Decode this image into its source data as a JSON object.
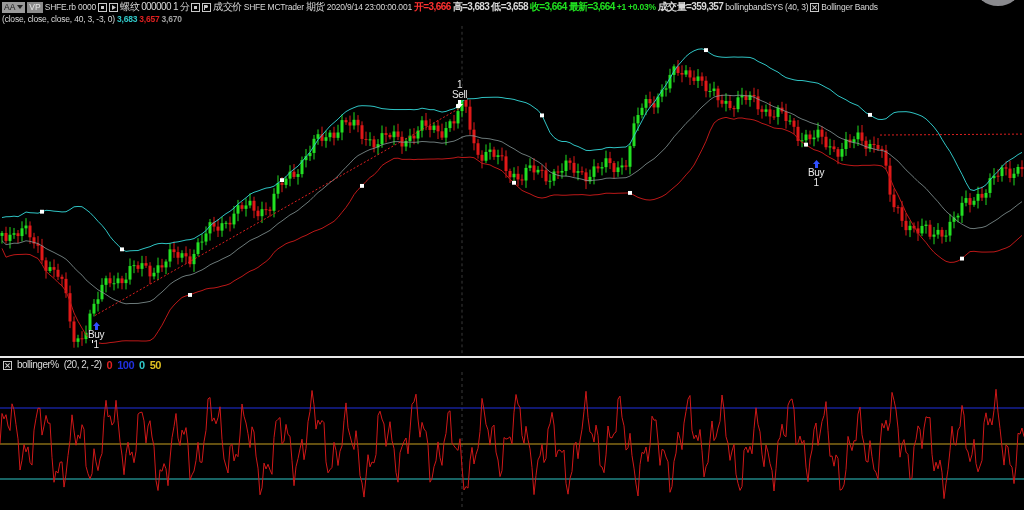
{
  "toolbar": {
    "font_button": "AA",
    "volume_profile_button": "VP",
    "symbol": "SHFE.rb 0000",
    "instrument": "螺纹 000000",
    "interval": "1 分",
    "price_type": "成交价",
    "exchange": "SHFE",
    "data_source": "MCTrader",
    "category": "期货",
    "date": "2020/9/14",
    "time": "23:00:00.001"
  },
  "quote": [
    {
      "text": "开=3,666",
      "color": "#ff3030"
    },
    {
      "text": "高=3,683",
      "color": "#d8d8d8"
    },
    {
      "text": "低=3,658",
      "color": "#d8d8d8"
    },
    {
      "text": "收=3,664",
      "color": "#20e020"
    },
    {
      "text": "最新=3,664",
      "color": "#20e020"
    },
    {
      "text": "+1",
      "color": "#20e020"
    },
    {
      "text": "+0.03%",
      "color": "#20e020"
    },
    {
      "text": "成交量=359,357",
      "color": "#d8d8d8"
    }
  ],
  "strategy": {
    "name": "bollingbandSYS (40, 3)"
  },
  "indicator": {
    "name": "Bollinger Bands",
    "params": "(close, close, close, 40, 3, -3, 0)",
    "values": [
      {
        "text": "3,683",
        "color": "#30c8c8"
      },
      {
        "text": "3,657",
        "color": "#e02020"
      },
      {
        "text": "3,670",
        "color": "#a0a0a0"
      }
    ]
  },
  "signals": [
    {
      "kind": "buy",
      "label": "Buy",
      "count": "1"
    },
    {
      "kind": "sell",
      "label": "Sell",
      "count": "1"
    },
    {
      "kind": "buy",
      "label": "Buy",
      "count": "1"
    }
  ],
  "oscillator": {
    "name": "bollinger%",
    "params": "(20, 2, -2)",
    "values": [
      {
        "text": "0",
        "color": "#e02020"
      },
      {
        "text": "100",
        "color": "#2030e0"
      },
      {
        "text": "0",
        "color": "#30c8c8"
      },
      {
        "text": "50",
        "color": "#e0c020"
      }
    ]
  }
}
